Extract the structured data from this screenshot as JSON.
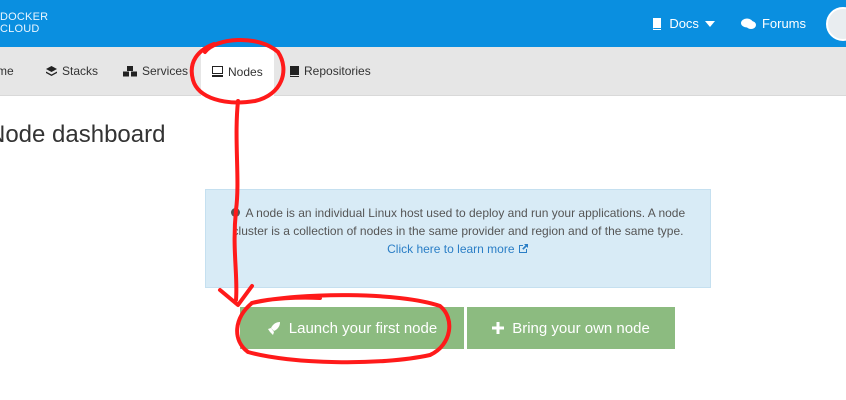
{
  "brand": {
    "line1": "DOCKER",
    "line2": "CLOUD"
  },
  "topnav": {
    "docs_label": "Docs",
    "forums_label": "Forums"
  },
  "subnav": {
    "items": [
      {
        "label": "me",
        "icon": "home-icon"
      },
      {
        "label": "Stacks",
        "icon": "layers-icon"
      },
      {
        "label": "Services",
        "icon": "cubes-icon"
      },
      {
        "label": "Nodes",
        "icon": "server-icon",
        "active": true
      },
      {
        "label": "Repositories",
        "icon": "book-icon"
      }
    ]
  },
  "page": {
    "title": "Node dashboard"
  },
  "info": {
    "text": "A node is an individual Linux host used to deploy and run your applications. A node cluster is a collection of nodes in the same provider and region and of the same type.",
    "link_text": "Click here to learn more"
  },
  "buttons": {
    "launch_label": "Launch your first node",
    "bring_label": "Bring your own node"
  },
  "colors": {
    "topbar": "#0a8fe0",
    "button": "#8cbb80",
    "annotation": "#ff0000",
    "info_bg": "#d8ebf6"
  }
}
